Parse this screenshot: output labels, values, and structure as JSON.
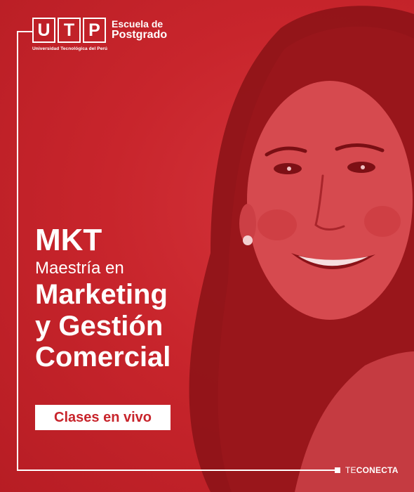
{
  "logo": {
    "letters": [
      "U",
      "T",
      "P"
    ],
    "tagline": "Universidad Tecnológica del Perú"
  },
  "school": {
    "line1": "Escuela de",
    "line2": "Postgrado"
  },
  "program": {
    "code": "MKT",
    "subtitle": "Maestría en",
    "title_lines": [
      "Marketing",
      "y Gestión",
      "Comercial"
    ]
  },
  "badge": "Clases en vivo",
  "brand": {
    "prefix": "TE",
    "suffix": "CONECTA"
  },
  "colors": {
    "brand_red": "#c8242b",
    "white": "#ffffff"
  }
}
